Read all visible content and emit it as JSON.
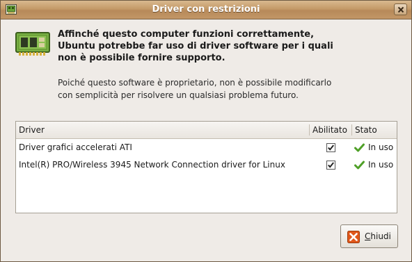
{
  "window": {
    "title": "Driver con restrizioni"
  },
  "message": {
    "primary": "Affinché questo computer funzioni correttamente, Ubuntu potrebbe far uso di driver software per i quali non è possibile fornire supporto.",
    "secondary": "Poiché questo software è proprietario, non è possibile modificarlo con semplicità per risolvere un qualsiasi problema futuro."
  },
  "table": {
    "headers": {
      "driver": "Driver",
      "enabled": "Abilitato",
      "status": "Stato"
    },
    "rows": [
      {
        "driver": "Driver grafici accelerati ATI",
        "enabled": true,
        "status": "In uso"
      },
      {
        "driver": "Intel(R) PRO/Wireless 3945 Network Connection driver for Linux",
        "enabled": true,
        "status": "In uso"
      }
    ]
  },
  "buttons": {
    "close_mnemonic": "C",
    "close_rest": "hiudi"
  },
  "icons": {
    "title_icon": "hardware-card-icon",
    "dialog_icon": "hardware-card-icon",
    "status_icon": "green-check-icon",
    "close_button_icon": "red-x-icon"
  },
  "colors": {
    "titlebar": "#c49a68",
    "status_check": "#4fa028",
    "close_icon": "#e0571a"
  }
}
